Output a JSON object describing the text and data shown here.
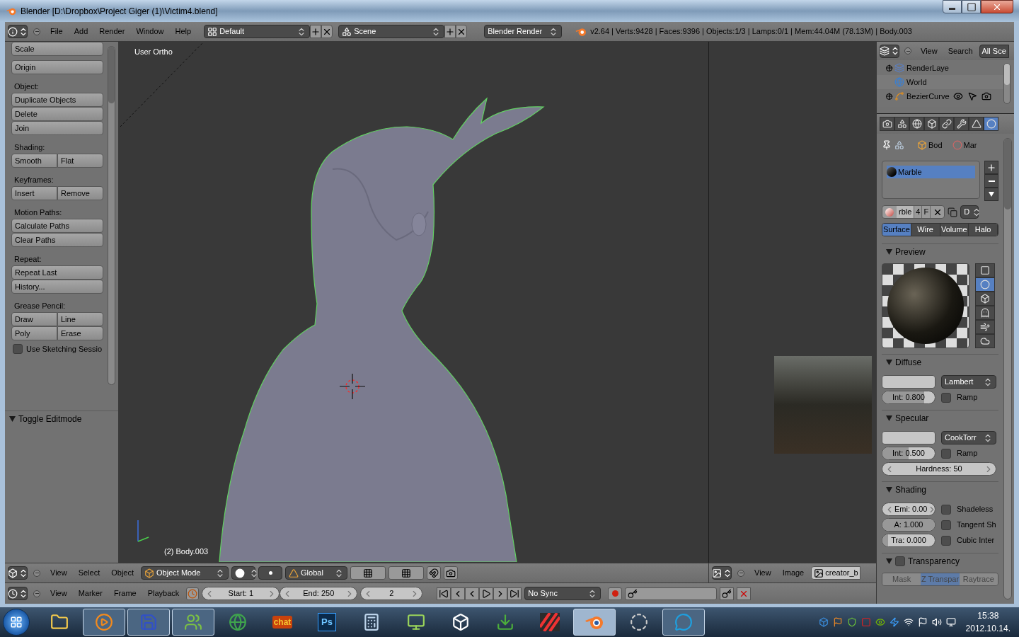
{
  "window": {
    "title": "Blender [D:\\Dropbox\\Project Giger (1)\\Victim4.blend]"
  },
  "info_header": {
    "menus": [
      "File",
      "Add",
      "Render",
      "Window",
      "Help"
    ],
    "screen": "Default",
    "scene": "Scene",
    "engine": "Blender Render",
    "stats": "v2.64 | Verts:9428 | Faces:9396 | Objects:1/3 | Lamps:0/1 | Mem:44.04M (78.13M) | Body.003"
  },
  "toolshelf": {
    "sections": [
      {
        "buttons": [
          [
            "Scale"
          ]
        ]
      },
      {
        "buttons": [
          [
            "Origin"
          ]
        ]
      },
      {
        "heading": "Object:",
        "buttons": [
          [
            "Duplicate Objects"
          ],
          [
            "Delete"
          ],
          [
            "Join"
          ]
        ]
      },
      {
        "heading": "Shading:",
        "buttons": [
          [
            "Smooth",
            "Flat"
          ]
        ]
      },
      {
        "heading": "Keyframes:",
        "buttons": [
          [
            "Insert",
            "Remove"
          ]
        ]
      },
      {
        "heading": "Motion Paths:",
        "buttons": [
          [
            "Calculate Paths"
          ],
          [
            "Clear Paths"
          ]
        ]
      },
      {
        "heading": "Repeat:",
        "buttons": [
          [
            "Repeat Last"
          ],
          [
            "History..."
          ]
        ]
      },
      {
        "heading": "Grease Pencil:",
        "buttons": [
          [
            "Draw",
            "Line"
          ],
          [
            "Poly",
            "Erase"
          ]
        ]
      }
    ],
    "sketching": {
      "label": "Use Sketching Sessio",
      "checked": false
    },
    "last_operator": {
      "label": "Toggle Editmode",
      "expanded": true
    }
  },
  "viewport": {
    "view_label": "User Ortho",
    "object_label": "(2) Body.003"
  },
  "view3d_header": {
    "menus": [
      "View",
      "Select",
      "Object"
    ],
    "mode": "Object Mode",
    "orientation": "Global"
  },
  "image_header": {
    "menus": [
      "View",
      "Image"
    ],
    "image_name": "creator_b"
  },
  "timeline": {
    "menus": [
      "View",
      "Marker",
      "Frame",
      "Playback"
    ],
    "start": "Start: 1",
    "end": "End: 250",
    "current": "2",
    "sync": "No Sync"
  },
  "outliner": {
    "menus": [
      "View",
      "Search"
    ],
    "filter": "All Sce",
    "items": [
      {
        "label": "RenderLaye",
        "kind": "renderlayers",
        "expanded": false
      },
      {
        "label": "World",
        "kind": "world"
      },
      {
        "label": "BezierCurve",
        "kind": "curve",
        "expanded": false
      }
    ]
  },
  "properties": {
    "tabs": [
      {
        "kind": "render",
        "selected": false
      },
      {
        "kind": "scene",
        "selected": false
      },
      {
        "kind": "world",
        "selected": false
      },
      {
        "kind": "object",
        "selected": false
      },
      {
        "kind": "constraints",
        "selected": false
      },
      {
        "kind": "modifiers",
        "selected": false
      },
      {
        "kind": "data",
        "selected": false
      },
      {
        "kind": "material",
        "selected": true
      }
    ],
    "breadcrumb": [
      "Bod",
      "Mar"
    ],
    "slots": [
      {
        "label": "Marble",
        "selected": true
      }
    ],
    "datablock": {
      "name": "rble",
      "users": "4",
      "fake": "F",
      "browse": "D"
    },
    "type_tabs": [
      {
        "label": "Surface",
        "selected": true
      },
      {
        "label": "Wire",
        "selected": false
      },
      {
        "label": "Volume",
        "selected": false
      },
      {
        "label": "Halo",
        "selected": false
      }
    ],
    "preview": {
      "title": "Preview",
      "expanded": true,
      "shapes": [
        {
          "kind": "flat",
          "selected": false
        },
        {
          "kind": "sphere",
          "selected": true
        },
        {
          "kind": "cube",
          "selected": false
        },
        {
          "kind": "monkey",
          "selected": false
        },
        {
          "kind": "hair",
          "selected": false
        },
        {
          "kind": "sky",
          "selected": false
        }
      ]
    },
    "diffuse": {
      "title": "Diffuse",
      "expanded": true,
      "shader": "Lambert",
      "intensity": "Int: 0.800",
      "level": 0.8,
      "ramp": {
        "label": "Ramp",
        "checked": false
      }
    },
    "specular": {
      "title": "Specular",
      "expanded": true,
      "shader": "CookTorr",
      "intensity": "Int: 0.500",
      "level": 0.5,
      "ramp": {
        "label": "Ramp",
        "checked": false
      },
      "hardness": "Hardness: 50"
    },
    "shading": {
      "title": "Shading",
      "expanded": true,
      "fields": [
        {
          "label": "Emi: 0.00",
          "kind": "stepper"
        },
        {
          "label": "A: 1.000",
          "kind": "slider",
          "level": 1
        },
        {
          "label": "Tra: 0.000",
          "kind": "slider",
          "level": 0
        }
      ],
      "options": [
        {
          "label": "Shadeless",
          "checked": false
        },
        {
          "label": "Tangent Sh",
          "checked": false
        },
        {
          "label": "Cubic Inter",
          "checked": false
        }
      ]
    },
    "transparency": {
      "title": "Transparency",
      "expanded": true,
      "checked": false,
      "modes": [
        {
          "label": "Mask",
          "selected": false
        },
        {
          "label": "Z Transpar",
          "selected": true
        },
        {
          "label": "Raytrace",
          "selected": false
        }
      ]
    }
  },
  "taskbar": {
    "apps": [
      {
        "kind": "folder",
        "running": false,
        "selected": false
      },
      {
        "kind": "media",
        "running": true,
        "selected": false
      },
      {
        "kind": "floppy",
        "running": true,
        "selected": false
      },
      {
        "kind": "people",
        "running": true,
        "selected": false
      },
      {
        "kind": "browser",
        "running": false,
        "selected": false
      },
      {
        "kind": "chat",
        "label": "chat",
        "running": false,
        "selected": false
      },
      {
        "kind": "photoshop",
        "label": "Ps",
        "running": false,
        "selected": false
      },
      {
        "kind": "calculator",
        "running": false,
        "selected": false
      },
      {
        "kind": "monitor",
        "running": false,
        "selected": false
      },
      {
        "kind": "unity",
        "running": false,
        "selected": false
      },
      {
        "kind": "torrent",
        "running": false,
        "selected": false
      },
      {
        "kind": "stripes",
        "running": false,
        "selected": false
      },
      {
        "kind": "blender",
        "running": true,
        "selected": true
      },
      {
        "kind": "ring",
        "running": false,
        "selected": false
      },
      {
        "kind": "skype",
        "running": true,
        "selected": false
      }
    ],
    "time": "15:38",
    "date": "2012.10.14."
  }
}
